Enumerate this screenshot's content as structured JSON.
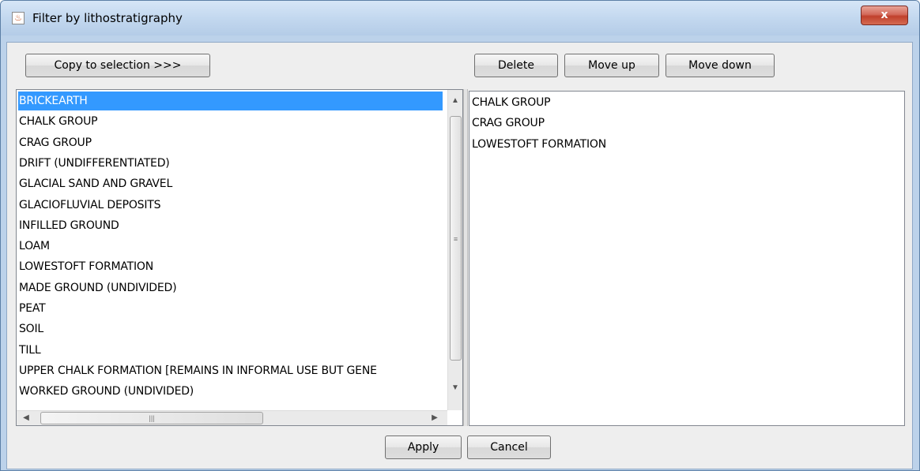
{
  "window": {
    "title": "Filter by lithostratigraphy",
    "close_label": "x",
    "app_icon": "java-cup-icon"
  },
  "toolbar": {
    "copy_label": "Copy to selection >>>",
    "delete_label": "Delete",
    "move_up_label": "Move up",
    "move_down_label": "Move down"
  },
  "available_list": {
    "items": [
      "BRICKEARTH",
      "CHALK GROUP",
      "CRAG GROUP",
      "DRIFT (UNDIFFERENTIATED)",
      "GLACIAL SAND AND GRAVEL",
      "GLACIOFLUVIAL DEPOSITS",
      "INFILLED GROUND",
      "LOAM",
      "LOWESTOFT FORMATION",
      "MADE GROUND (UNDIVIDED)",
      "PEAT",
      "SOIL",
      "TILL",
      "UPPER CHALK FORMATION [REMAINS IN INFORMAL USE BUT GENE",
      "WORKED GROUND (UNDIVIDED)"
    ],
    "selected_index": 0
  },
  "selection_list": {
    "items": [
      "CHALK GROUP",
      "CRAG GROUP",
      "LOWESTOFT FORMATION"
    ]
  },
  "footer": {
    "apply_label": "Apply",
    "cancel_label": "Cancel"
  },
  "colors": {
    "selection_highlight": "#3399ff",
    "title_bar": "#c3d8ef",
    "close_button": "#c8452f"
  }
}
